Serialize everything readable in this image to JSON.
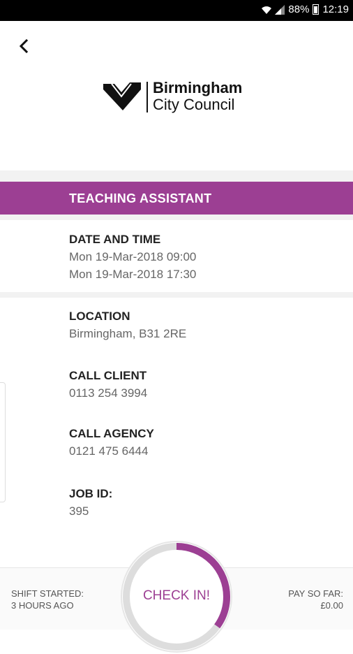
{
  "status_bar": {
    "battery": "88%",
    "time": "12:19",
    "icons": [
      "wifi-icon",
      "signal-icon",
      "battery-icon"
    ]
  },
  "header": {
    "back_icon": "chevron-left-icon",
    "logo": {
      "line1": "Birmingham",
      "line2": "City Council",
      "icon": "heart-logo-icon"
    }
  },
  "job": {
    "title": "TEACHING ASSISTANT",
    "date_label": "DATE AND TIME",
    "date_start": "Mon 19-Mar-2018 09:00",
    "date_end": "Mon 19-Mar-2018 17:30",
    "location_label": "LOCATION",
    "location": "Birmingham, B31 2RE",
    "client_label": "CALL CLIENT",
    "client_phone": "0113 254 3994",
    "agency_label": "CALL AGENCY",
    "agency_phone": "0121 475 6444",
    "id_label": "JOB ID:",
    "id": "395"
  },
  "footer": {
    "shift_label": "SHIFT STARTED:",
    "shift_value": "3 HOURS AGO",
    "pay_label": "PAY SO FAR:",
    "pay_value": "£0.00",
    "check_in_label": "CHECK IN!",
    "progress": 0.35
  },
  "colors": {
    "accent": "#9c3f93",
    "status_bar": "#000000",
    "divider": "#f2f2f2"
  }
}
